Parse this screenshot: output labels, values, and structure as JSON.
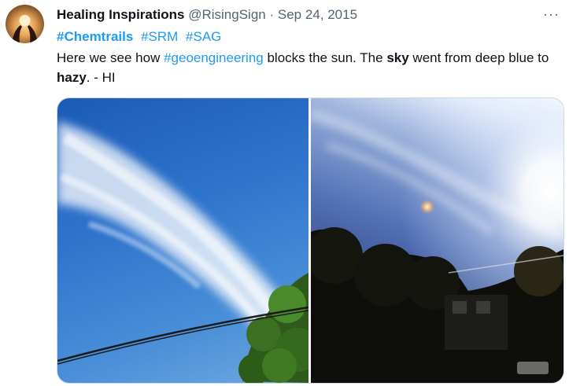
{
  "tweet": {
    "author_name": "Healing Inspirations",
    "handle": "@RisingSign",
    "separator": "·",
    "date": "Sep 24, 2015",
    "more_label": "···",
    "hashtags": [
      "#Chemtrails",
      "#SRM",
      "#SAG"
    ],
    "text": {
      "part1": "Here we see how ",
      "link": "#geoengineering",
      "part2": " blocks the sun. The ",
      "bold1": "sky",
      "part3": " went from deep blue to ",
      "bold2": "hazy",
      "part4": ". - HI"
    }
  },
  "colors": {
    "link": "#1d9bf0",
    "secondary_text": "#536471",
    "primary_text": "#0f1419"
  },
  "icons": {
    "avatar": "hands-sunset-avatar",
    "more": "more-options-icon"
  }
}
